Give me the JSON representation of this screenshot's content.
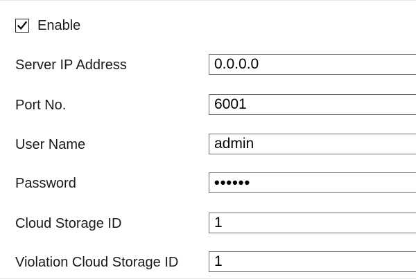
{
  "enable": {
    "label": "Enable",
    "checked": true
  },
  "fields": [
    {
      "label": "Server IP Address",
      "value": "0.0.0.0",
      "type": "text"
    },
    {
      "label": "Port No.",
      "value": "6001",
      "type": "text"
    },
    {
      "label": "User Name",
      "value": "admin",
      "type": "text"
    },
    {
      "label": "Password",
      "value": "••••••",
      "type": "password"
    },
    {
      "label": "Cloud Storage ID",
      "value": "1",
      "type": "text"
    },
    {
      "label": "Violation Cloud Storage ID",
      "value": "1",
      "type": "text"
    }
  ]
}
